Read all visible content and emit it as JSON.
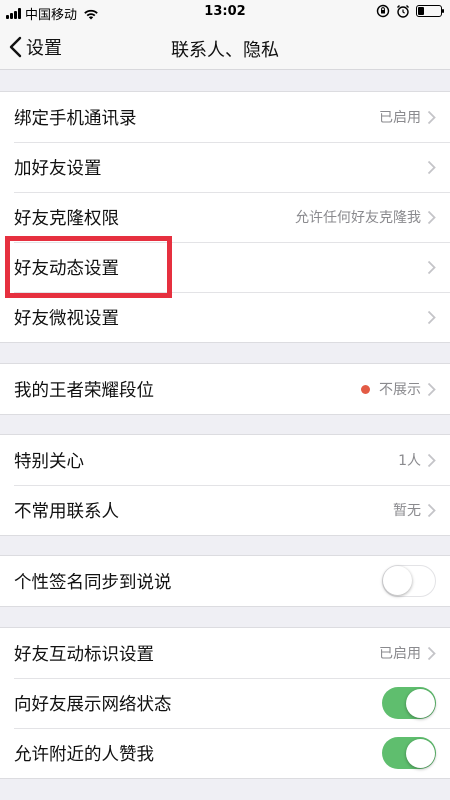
{
  "status": {
    "carrier": "中国移动",
    "time": "13:02",
    "battery_level": 0.25
  },
  "nav": {
    "back_label": "设置",
    "title": "联系人、隐私"
  },
  "groups": [
    {
      "rows": [
        {
          "label": "绑定手机通讯录",
          "value": "已启用"
        },
        {
          "label": "加好友设置",
          "value": ""
        },
        {
          "label": "好友克隆权限",
          "value": "允许任何好友克隆我"
        },
        {
          "label": "好友动态设置",
          "value": ""
        },
        {
          "label": "好友微视设置",
          "value": ""
        }
      ]
    },
    {
      "rows": [
        {
          "label": "我的王者荣耀段位",
          "value": "不展示"
        }
      ]
    },
    {
      "rows": [
        {
          "label": "特别关心",
          "value": "1人"
        },
        {
          "label": "不常用联系人",
          "value": "暂无"
        }
      ]
    },
    {
      "rows": [
        {
          "label": "个性签名同步到说说",
          "toggle": "off"
        }
      ]
    },
    {
      "rows": [
        {
          "label": "好友互动标识设置",
          "value": "已启用"
        },
        {
          "label": "向好友展示网络状态",
          "toggle": "on"
        },
        {
          "label": "允许附近的人赞我",
          "toggle": "on"
        }
      ]
    }
  ],
  "colors": {
    "toggle_on": "#5fbe6e",
    "highlight": "#e6303f",
    "status_dot": "#e35b45"
  }
}
